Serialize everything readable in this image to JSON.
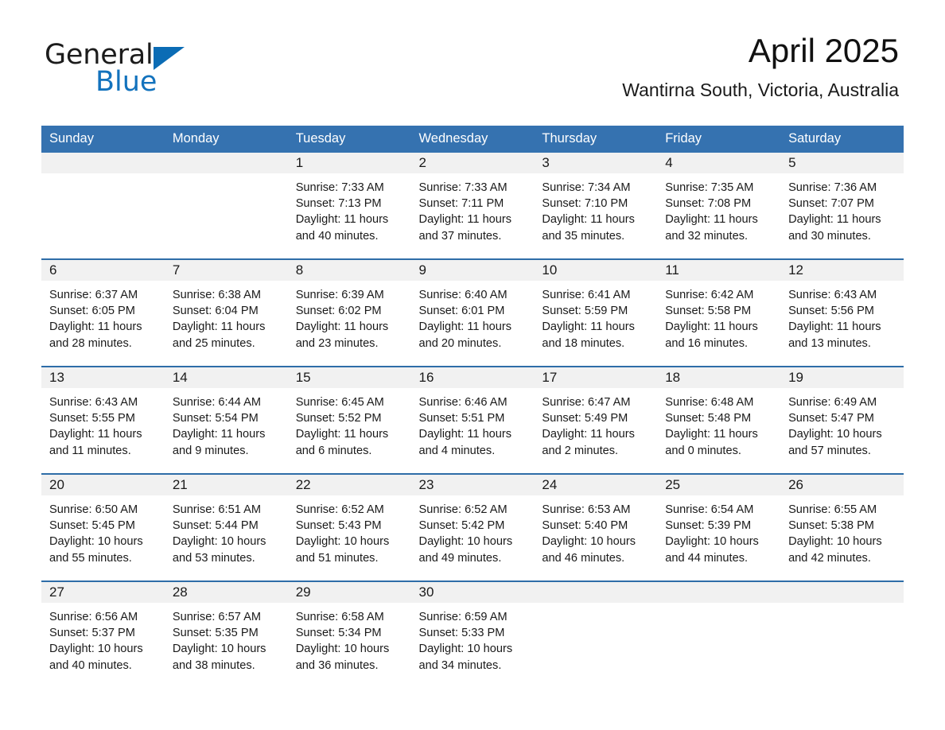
{
  "brand": {
    "name_part1": "General",
    "name_part2": "Blue",
    "triangle_color": "#0b6cb5",
    "blue_text_color": "#1272bd"
  },
  "header": {
    "title": "April 2025",
    "subtitle": "Wantirna South, Victoria, Australia"
  },
  "theme": {
    "header_bar_color": "#3572b0",
    "row_divider_color": "#2e6da8",
    "daynum_band_color": "#f1f1f1",
    "page_background": "#ffffff",
    "text_color": "#1a1a1a"
  },
  "weekday_headers": [
    "Sunday",
    "Monday",
    "Tuesday",
    "Wednesday",
    "Thursday",
    "Friday",
    "Saturday"
  ],
  "labels": {
    "sunrise_prefix": "Sunrise:",
    "sunset_prefix": "Sunset:",
    "daylight_prefix": "Daylight:"
  },
  "weeks": [
    [
      {
        "day": "",
        "line1": "",
        "line2": "",
        "line3": "",
        "line4": ""
      },
      {
        "day": "",
        "line1": "",
        "line2": "",
        "line3": "",
        "line4": ""
      },
      {
        "day": "1",
        "line1": "Sunrise: 7:33 AM",
        "line2": "Sunset: 7:13 PM",
        "line3": "Daylight: 11 hours",
        "line4": "and 40 minutes."
      },
      {
        "day": "2",
        "line1": "Sunrise: 7:33 AM",
        "line2": "Sunset: 7:11 PM",
        "line3": "Daylight: 11 hours",
        "line4": "and 37 minutes."
      },
      {
        "day": "3",
        "line1": "Sunrise: 7:34 AM",
        "line2": "Sunset: 7:10 PM",
        "line3": "Daylight: 11 hours",
        "line4": "and 35 minutes."
      },
      {
        "day": "4",
        "line1": "Sunrise: 7:35 AM",
        "line2": "Sunset: 7:08 PM",
        "line3": "Daylight: 11 hours",
        "line4": "and 32 minutes."
      },
      {
        "day": "5",
        "line1": "Sunrise: 7:36 AM",
        "line2": "Sunset: 7:07 PM",
        "line3": "Daylight: 11 hours",
        "line4": "and 30 minutes."
      }
    ],
    [
      {
        "day": "6",
        "line1": "Sunrise: 6:37 AM",
        "line2": "Sunset: 6:05 PM",
        "line3": "Daylight: 11 hours",
        "line4": "and 28 minutes."
      },
      {
        "day": "7",
        "line1": "Sunrise: 6:38 AM",
        "line2": "Sunset: 6:04 PM",
        "line3": "Daylight: 11 hours",
        "line4": "and 25 minutes."
      },
      {
        "day": "8",
        "line1": "Sunrise: 6:39 AM",
        "line2": "Sunset: 6:02 PM",
        "line3": "Daylight: 11 hours",
        "line4": "and 23 minutes."
      },
      {
        "day": "9",
        "line1": "Sunrise: 6:40 AM",
        "line2": "Sunset: 6:01 PM",
        "line3": "Daylight: 11 hours",
        "line4": "and 20 minutes."
      },
      {
        "day": "10",
        "line1": "Sunrise: 6:41 AM",
        "line2": "Sunset: 5:59 PM",
        "line3": "Daylight: 11 hours",
        "line4": "and 18 minutes."
      },
      {
        "day": "11",
        "line1": "Sunrise: 6:42 AM",
        "line2": "Sunset: 5:58 PM",
        "line3": "Daylight: 11 hours",
        "line4": "and 16 minutes."
      },
      {
        "day": "12",
        "line1": "Sunrise: 6:43 AM",
        "line2": "Sunset: 5:56 PM",
        "line3": "Daylight: 11 hours",
        "line4": "and 13 minutes."
      }
    ],
    [
      {
        "day": "13",
        "line1": "Sunrise: 6:43 AM",
        "line2": "Sunset: 5:55 PM",
        "line3": "Daylight: 11 hours",
        "line4": "and 11 minutes."
      },
      {
        "day": "14",
        "line1": "Sunrise: 6:44 AM",
        "line2": "Sunset: 5:54 PM",
        "line3": "Daylight: 11 hours",
        "line4": "and 9 minutes."
      },
      {
        "day": "15",
        "line1": "Sunrise: 6:45 AM",
        "line2": "Sunset: 5:52 PM",
        "line3": "Daylight: 11 hours",
        "line4": "and 6 minutes."
      },
      {
        "day": "16",
        "line1": "Sunrise: 6:46 AM",
        "line2": "Sunset: 5:51 PM",
        "line3": "Daylight: 11 hours",
        "line4": "and 4 minutes."
      },
      {
        "day": "17",
        "line1": "Sunrise: 6:47 AM",
        "line2": "Sunset: 5:49 PM",
        "line3": "Daylight: 11 hours",
        "line4": "and 2 minutes."
      },
      {
        "day": "18",
        "line1": "Sunrise: 6:48 AM",
        "line2": "Sunset: 5:48 PM",
        "line3": "Daylight: 11 hours",
        "line4": "and 0 minutes."
      },
      {
        "day": "19",
        "line1": "Sunrise: 6:49 AM",
        "line2": "Sunset: 5:47 PM",
        "line3": "Daylight: 10 hours",
        "line4": "and 57 minutes."
      }
    ],
    [
      {
        "day": "20",
        "line1": "Sunrise: 6:50 AM",
        "line2": "Sunset: 5:45 PM",
        "line3": "Daylight: 10 hours",
        "line4": "and 55 minutes."
      },
      {
        "day": "21",
        "line1": "Sunrise: 6:51 AM",
        "line2": "Sunset: 5:44 PM",
        "line3": "Daylight: 10 hours",
        "line4": "and 53 minutes."
      },
      {
        "day": "22",
        "line1": "Sunrise: 6:52 AM",
        "line2": "Sunset: 5:43 PM",
        "line3": "Daylight: 10 hours",
        "line4": "and 51 minutes."
      },
      {
        "day": "23",
        "line1": "Sunrise: 6:52 AM",
        "line2": "Sunset: 5:42 PM",
        "line3": "Daylight: 10 hours",
        "line4": "and 49 minutes."
      },
      {
        "day": "24",
        "line1": "Sunrise: 6:53 AM",
        "line2": "Sunset: 5:40 PM",
        "line3": "Daylight: 10 hours",
        "line4": "and 46 minutes."
      },
      {
        "day": "25",
        "line1": "Sunrise: 6:54 AM",
        "line2": "Sunset: 5:39 PM",
        "line3": "Daylight: 10 hours",
        "line4": "and 44 minutes."
      },
      {
        "day": "26",
        "line1": "Sunrise: 6:55 AM",
        "line2": "Sunset: 5:38 PM",
        "line3": "Daylight: 10 hours",
        "line4": "and 42 minutes."
      }
    ],
    [
      {
        "day": "27",
        "line1": "Sunrise: 6:56 AM",
        "line2": "Sunset: 5:37 PM",
        "line3": "Daylight: 10 hours",
        "line4": "and 40 minutes."
      },
      {
        "day": "28",
        "line1": "Sunrise: 6:57 AM",
        "line2": "Sunset: 5:35 PM",
        "line3": "Daylight: 10 hours",
        "line4": "and 38 minutes."
      },
      {
        "day": "29",
        "line1": "Sunrise: 6:58 AM",
        "line2": "Sunset: 5:34 PM",
        "line3": "Daylight: 10 hours",
        "line4": "and 36 minutes."
      },
      {
        "day": "30",
        "line1": "Sunrise: 6:59 AM",
        "line2": "Sunset: 5:33 PM",
        "line3": "Daylight: 10 hours",
        "line4": "and 34 minutes."
      },
      {
        "day": "",
        "line1": "",
        "line2": "",
        "line3": "",
        "line4": ""
      },
      {
        "day": "",
        "line1": "",
        "line2": "",
        "line3": "",
        "line4": ""
      },
      {
        "day": "",
        "line1": "",
        "line2": "",
        "line3": "",
        "line4": ""
      }
    ]
  ]
}
